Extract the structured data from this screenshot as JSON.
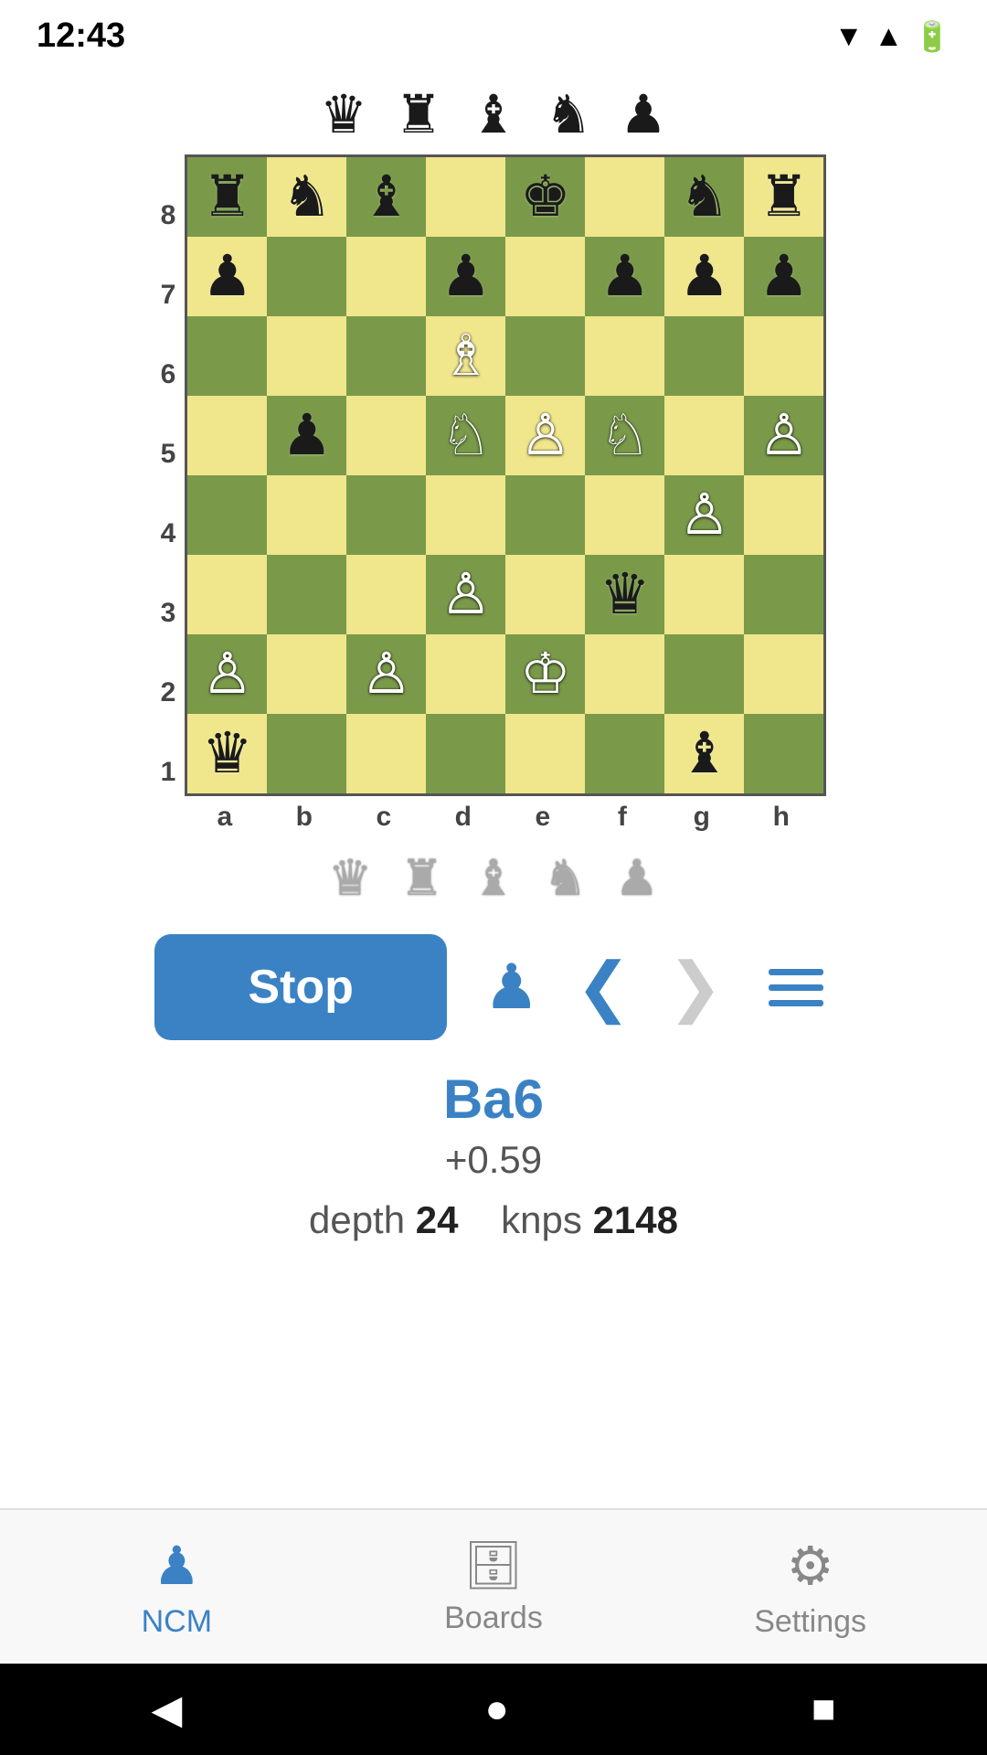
{
  "statusBar": {
    "time": "12:43",
    "icons": [
      "wifi",
      "signal",
      "battery"
    ]
  },
  "capturedTop": {
    "pieces": [
      "♛",
      "♜",
      "♝",
      "♞",
      "♟"
    ]
  },
  "capturedBottom": {
    "pieces": [
      "♛",
      "♜",
      "♝",
      "♞",
      "♟"
    ]
  },
  "board": {
    "rankLabels": [
      "8",
      "7",
      "6",
      "5",
      "4",
      "3",
      "2",
      "1"
    ],
    "fileLabels": [
      "a",
      "b",
      "c",
      "d",
      "e",
      "f",
      "g",
      "h"
    ],
    "cells": [
      {
        "rank": 8,
        "file": "a",
        "piece": "♜",
        "color": "dark"
      },
      {
        "rank": 8,
        "file": "b",
        "piece": "♞",
        "color": "light"
      },
      {
        "rank": 8,
        "file": "c",
        "piece": "♝",
        "color": "dark"
      },
      {
        "rank": 8,
        "file": "d",
        "piece": "",
        "color": "light"
      },
      {
        "rank": 8,
        "file": "e",
        "piece": "♚",
        "color": "dark"
      },
      {
        "rank": 8,
        "file": "f",
        "piece": "",
        "color": "light"
      },
      {
        "rank": 8,
        "file": "g",
        "piece": "♞",
        "color": "dark"
      },
      {
        "rank": 8,
        "file": "h",
        "piece": "♜",
        "color": "light"
      },
      {
        "rank": 7,
        "file": "a",
        "piece": "♟",
        "color": "light"
      },
      {
        "rank": 7,
        "file": "b",
        "piece": "",
        "color": "dark"
      },
      {
        "rank": 7,
        "file": "c",
        "piece": "",
        "color": "light"
      },
      {
        "rank": 7,
        "file": "d",
        "piece": "♟",
        "color": "dark"
      },
      {
        "rank": 7,
        "file": "e",
        "piece": "",
        "color": "light"
      },
      {
        "rank": 7,
        "file": "f",
        "piece": "♟",
        "color": "dark"
      },
      {
        "rank": 7,
        "file": "g",
        "piece": "♟",
        "color": "light"
      },
      {
        "rank": 7,
        "file": "h",
        "piece": "♟",
        "color": "dark"
      },
      {
        "rank": 6,
        "file": "a",
        "piece": "",
        "color": "dark"
      },
      {
        "rank": 6,
        "file": "b",
        "piece": "",
        "color": "light"
      },
      {
        "rank": 6,
        "file": "c",
        "piece": "",
        "color": "dark"
      },
      {
        "rank": 6,
        "file": "d",
        "piece": "♗",
        "color": "light"
      },
      {
        "rank": 6,
        "file": "e",
        "piece": "",
        "color": "dark"
      },
      {
        "rank": 6,
        "file": "f",
        "piece": "",
        "color": "light"
      },
      {
        "rank": 6,
        "file": "g",
        "piece": "",
        "color": "dark"
      },
      {
        "rank": 6,
        "file": "h",
        "piece": "",
        "color": "light"
      },
      {
        "rank": 5,
        "file": "a",
        "piece": "",
        "color": "light"
      },
      {
        "rank": 5,
        "file": "b",
        "piece": "♟",
        "color": "dark"
      },
      {
        "rank": 5,
        "file": "c",
        "piece": "",
        "color": "light"
      },
      {
        "rank": 5,
        "file": "d",
        "piece": "♘",
        "color": "dark"
      },
      {
        "rank": 5,
        "file": "e",
        "piece": "♙",
        "color": "light"
      },
      {
        "rank": 5,
        "file": "f",
        "piece": "♘",
        "color": "dark"
      },
      {
        "rank": 5,
        "file": "g",
        "piece": "",
        "color": "light"
      },
      {
        "rank": 5,
        "file": "h",
        "piece": "♙",
        "color": "dark"
      },
      {
        "rank": 4,
        "file": "a",
        "piece": "",
        "color": "dark"
      },
      {
        "rank": 4,
        "file": "b",
        "piece": "",
        "color": "light"
      },
      {
        "rank": 4,
        "file": "c",
        "piece": "",
        "color": "dark"
      },
      {
        "rank": 4,
        "file": "d",
        "piece": "",
        "color": "light"
      },
      {
        "rank": 4,
        "file": "e",
        "piece": "",
        "color": "dark"
      },
      {
        "rank": 4,
        "file": "f",
        "piece": "",
        "color": "light"
      },
      {
        "rank": 4,
        "file": "g",
        "piece": "♙",
        "color": "dark"
      },
      {
        "rank": 4,
        "file": "h",
        "piece": "",
        "color": "light"
      },
      {
        "rank": 3,
        "file": "a",
        "piece": "",
        "color": "light"
      },
      {
        "rank": 3,
        "file": "b",
        "piece": "",
        "color": "dark"
      },
      {
        "rank": 3,
        "file": "c",
        "piece": "",
        "color": "light"
      },
      {
        "rank": 3,
        "file": "d",
        "piece": "♙",
        "color": "dark"
      },
      {
        "rank": 3,
        "file": "e",
        "piece": "",
        "color": "light"
      },
      {
        "rank": 3,
        "file": "f",
        "piece": "♛",
        "color": "dark"
      },
      {
        "rank": 3,
        "file": "g",
        "piece": "",
        "color": "light"
      },
      {
        "rank": 3,
        "file": "h",
        "piece": "",
        "color": "dark"
      },
      {
        "rank": 2,
        "file": "a",
        "piece": "♙",
        "color": "dark"
      },
      {
        "rank": 2,
        "file": "b",
        "piece": "",
        "color": "light"
      },
      {
        "rank": 2,
        "file": "c",
        "piece": "♙",
        "color": "dark"
      },
      {
        "rank": 2,
        "file": "d",
        "piece": "",
        "color": "light"
      },
      {
        "rank": 2,
        "file": "e",
        "piece": "♔",
        "color": "dark"
      },
      {
        "rank": 2,
        "file": "f",
        "piece": "",
        "color": "light"
      },
      {
        "rank": 2,
        "file": "g",
        "piece": "",
        "color": "dark"
      },
      {
        "rank": 2,
        "file": "h",
        "piece": "",
        "color": "light"
      },
      {
        "rank": 1,
        "file": "a",
        "piece": "♛",
        "color": "light"
      },
      {
        "rank": 1,
        "file": "b",
        "piece": "",
        "color": "dark"
      },
      {
        "rank": 1,
        "file": "c",
        "piece": "",
        "color": "light"
      },
      {
        "rank": 1,
        "file": "d",
        "piece": "",
        "color": "dark"
      },
      {
        "rank": 1,
        "file": "e",
        "piece": "",
        "color": "light"
      },
      {
        "rank": 1,
        "file": "f",
        "piece": "",
        "color": "dark"
      },
      {
        "rank": 1,
        "file": "g",
        "piece": "♝",
        "color": "light"
      },
      {
        "rank": 1,
        "file": "h",
        "piece": "",
        "color": "dark"
      }
    ]
  },
  "controls": {
    "stopLabel": "Stop",
    "prevDisabled": false,
    "nextDisabled": true
  },
  "analysis": {
    "move": "Ba6",
    "eval": "+0.59",
    "depthLabel": "depth",
    "depthValue": "24",
    "knpsLabel": "knps",
    "knpsValue": "2148"
  },
  "bottomNav": {
    "items": [
      {
        "id": "ncm",
        "label": "NCM",
        "active": true,
        "icon": "♟"
      },
      {
        "id": "boards",
        "label": "Boards",
        "active": false,
        "icon": "💾"
      },
      {
        "id": "settings",
        "label": "Settings",
        "active": false,
        "icon": "⚙"
      }
    ]
  }
}
